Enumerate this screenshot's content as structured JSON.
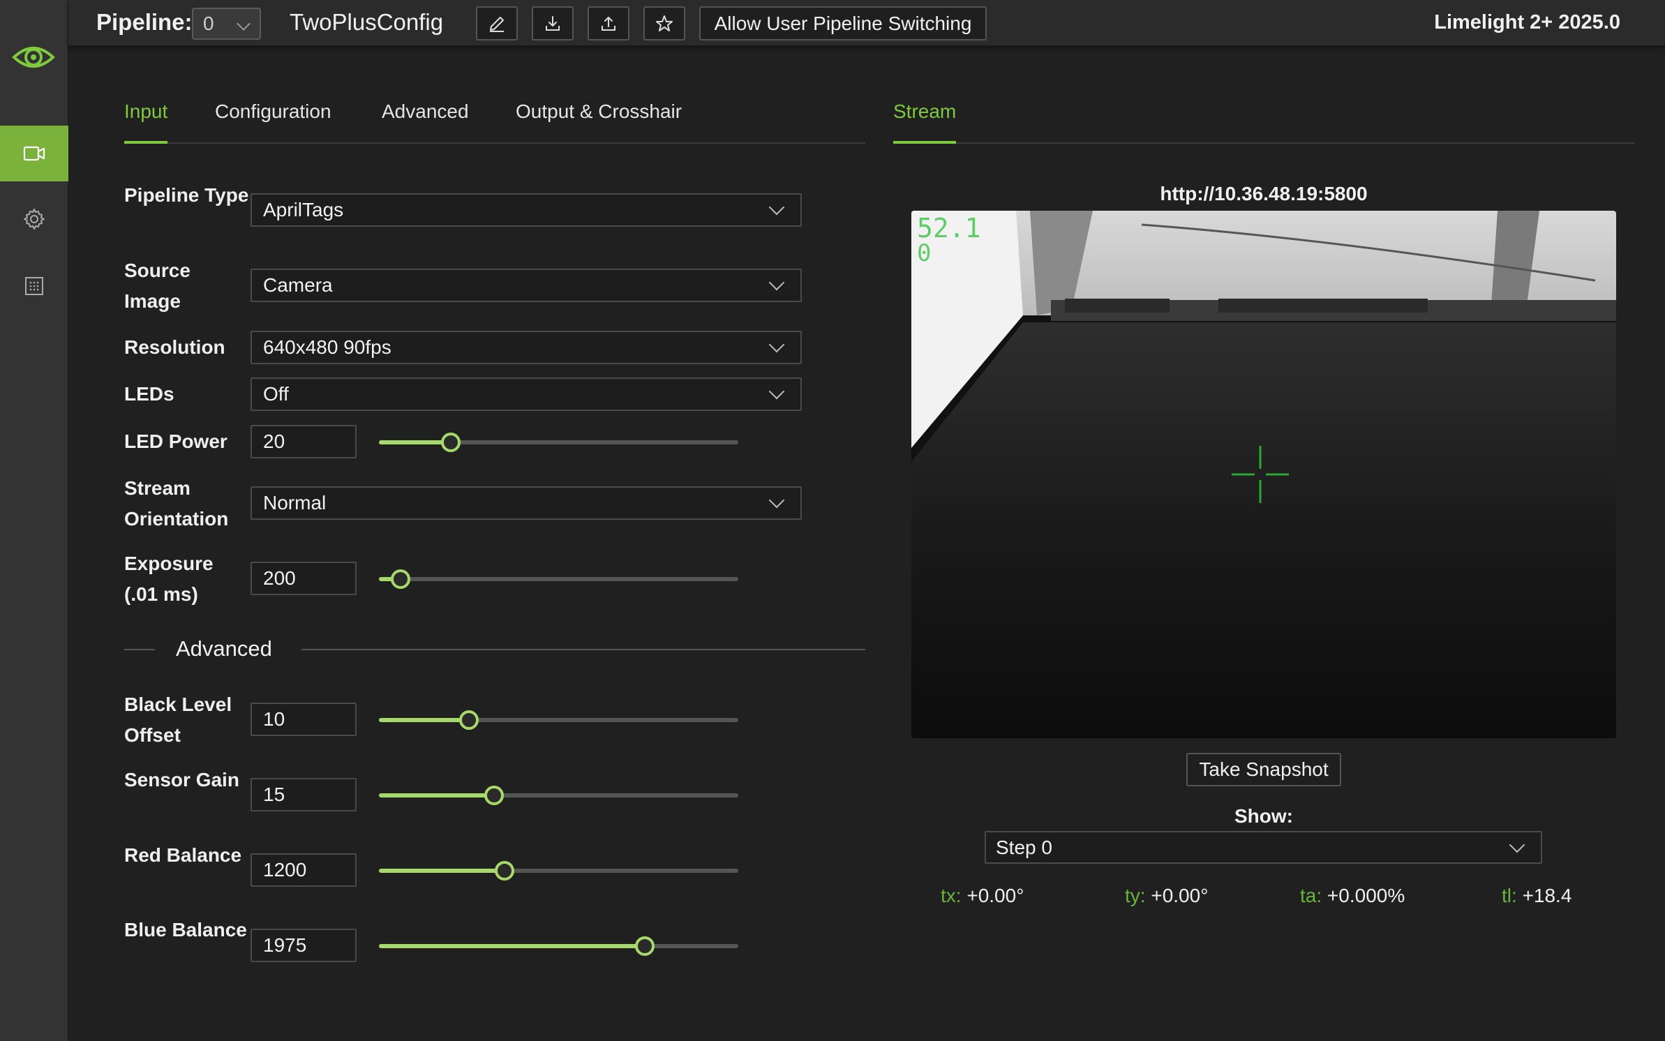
{
  "sidebar": {
    "logo_icon": "limelight-eye-icon",
    "items": [
      {
        "icon": "camera-icon",
        "active": true
      },
      {
        "icon": "gear-icon",
        "active": false
      },
      {
        "icon": "grid-icon",
        "active": false
      }
    ]
  },
  "topbar": {
    "pipeline_label": "Pipeline:",
    "pipeline_value": "0",
    "config_name": "TwoPlusConfig",
    "buttons": [
      "edit-icon",
      "download-icon",
      "upload-icon",
      "star-icon"
    ],
    "switch_label": "Allow User Pipeline Switching",
    "version": "Limelight 2+ 2025.0"
  },
  "tabs": {
    "left": [
      "Input",
      "Configuration",
      "Advanced",
      "Output & Crosshair"
    ],
    "active_left": "Input",
    "right": [
      "Stream"
    ]
  },
  "input": {
    "pipeline_type": {
      "label": "Pipeline Type",
      "value": "AprilTags"
    },
    "source_image": {
      "label": "Source Image",
      "value": "Camera"
    },
    "resolution": {
      "label": "Resolution",
      "value": "640x480 90fps"
    },
    "leds": {
      "label": "LEDs",
      "value": "Off"
    },
    "led_power": {
      "label": "LED Power",
      "value": "20",
      "fraction": 0.2
    },
    "stream_orientation": {
      "label": "Stream Orientation",
      "value": "Normal"
    },
    "exposure": {
      "label": "Exposure (.01 ms)",
      "value": "200",
      "fraction": 0.06
    }
  },
  "advanced": {
    "title": "Advanced",
    "black_level": {
      "label": "Black Level Offset",
      "value": "10",
      "fraction": 0.25
    },
    "sensor_gain": {
      "label": "Sensor Gain",
      "value": "15",
      "fraction": 0.32
    },
    "red_balance": {
      "label": "Red Balance",
      "value": "1200",
      "fraction": 0.35
    },
    "blue_balance": {
      "label": "Blue Balance",
      "value": "1975",
      "fraction": 0.74
    }
  },
  "stream": {
    "url": "http://10.36.48.19:5800",
    "overlay_text": "52.1",
    "overlay_sub": "0",
    "snapshot_label": "Take Snapshot",
    "show_label": "Show:",
    "show_value": "Step 0",
    "metrics": [
      {
        "key": "tx:",
        "value": "+0.00°"
      },
      {
        "key": "ty:",
        "value": "+0.00°"
      },
      {
        "key": "ta:",
        "value": "+0.000%"
      },
      {
        "key": "tl:",
        "value": "+18.4"
      }
    ]
  },
  "colors": {
    "accent": "#7fc93d",
    "slider": "#a6d96a",
    "metric_key": "#6ab43a"
  }
}
